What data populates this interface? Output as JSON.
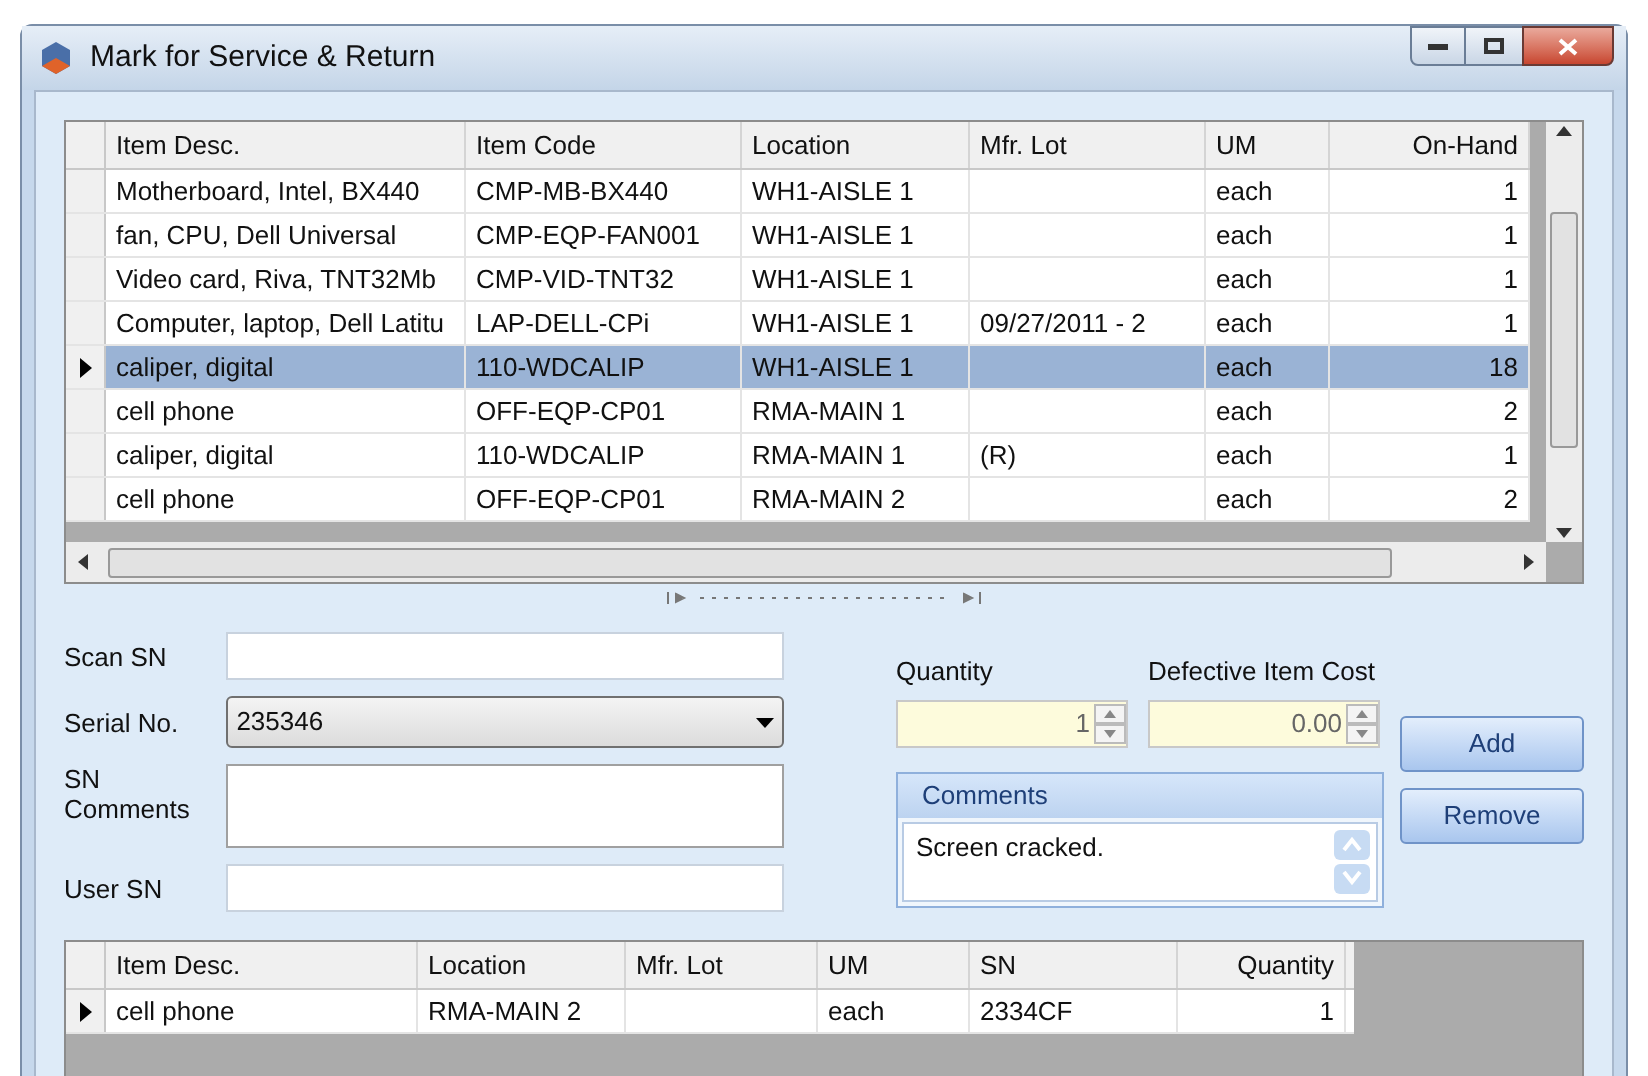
{
  "window": {
    "title": "Mark for Service & Return"
  },
  "items_grid": {
    "columns": [
      "Item Desc.",
      "Item Code",
      "Location",
      "Mfr. Lot",
      "UM",
      "On-Hand"
    ],
    "rows": [
      {
        "cells": [
          "Motherboard, Intel, BX440",
          "CMP-MB-BX440",
          "WH1-AISLE 1",
          "",
          "each",
          "1"
        ],
        "selected": false
      },
      {
        "cells": [
          "fan, CPU, Dell Universal",
          "CMP-EQP-FAN001",
          "WH1-AISLE 1",
          "",
          "each",
          "1"
        ],
        "selected": false
      },
      {
        "cells": [
          "Video card, Riva, TNT32Mb",
          "CMP-VID-TNT32",
          "WH1-AISLE 1",
          "",
          "each",
          "1"
        ],
        "selected": false
      },
      {
        "cells": [
          "Computer, laptop, Dell Latitu",
          "LAP-DELL-CPi",
          "WH1-AISLE 1",
          "09/27/2011 - 2",
          "each",
          "1"
        ],
        "selected": false
      },
      {
        "cells": [
          "caliper, digital",
          "110-WDCALIP",
          "WH1-AISLE 1",
          "",
          "each",
          "18"
        ],
        "selected": true
      },
      {
        "cells": [
          "cell phone",
          "OFF-EQP-CP01",
          "RMA-MAIN 1",
          "",
          "each",
          "2"
        ],
        "selected": false
      },
      {
        "cells": [
          "caliper, digital",
          "110-WDCALIP",
          "RMA-MAIN 1",
          "(R)",
          "each",
          "1"
        ],
        "selected": false
      },
      {
        "cells": [
          "cell phone",
          "OFF-EQP-CP01",
          "RMA-MAIN 2",
          "",
          "each",
          "2"
        ],
        "selected": false
      }
    ]
  },
  "form": {
    "scan_sn": {
      "label": "Scan SN"
    },
    "serial_no": {
      "label": "Serial No.",
      "value": "235346"
    },
    "sn_comments": {
      "label": "SN Comments"
    },
    "user_sn": {
      "label": "User SN"
    },
    "quantity": {
      "label": "Quantity",
      "value": "1"
    },
    "defective_item_cost": {
      "label": "Defective Item Cost",
      "value": "0.00"
    },
    "comments": {
      "title": "Comments",
      "value": "Screen cracked."
    },
    "buttons": [
      "Add",
      "Remove"
    ]
  },
  "selected_grid": {
    "columns": [
      "Item Desc.",
      "Location",
      "Mfr. Lot",
      "UM",
      "SN",
      "Quantity"
    ],
    "rows": [
      {
        "cells": [
          "cell phone",
          "RMA-MAIN 2",
          "",
          "each",
          "2334CF",
          "1"
        ],
        "selected": true
      }
    ]
  }
}
